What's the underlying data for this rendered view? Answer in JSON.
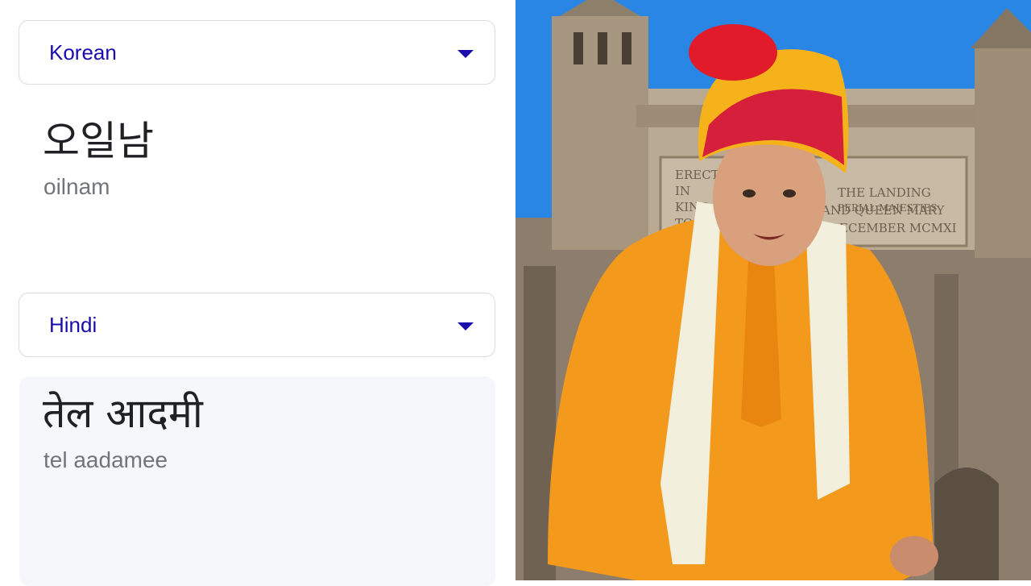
{
  "source": {
    "language": "Korean",
    "text": "오일남",
    "romanization": "oilnam"
  },
  "target": {
    "language": "Hindi",
    "text": "तेल आदमी",
    "romanization": "tel aadamee"
  },
  "photo": {
    "inscription_lines": [
      "ERECT",
      "IN",
      "KING",
      "TO",
      "AND QUEEN MARY",
      "DECEMBER MCMXI",
      "THE LANDING",
      "PERIAL MAJESTIES"
    ]
  },
  "colors": {
    "accent": "#1a0dab",
    "sky": "#1f7fe0",
    "kurta": "#f39a1c",
    "turban_red": "#d61f3a",
    "turban_yellow": "#f6b21a"
  },
  "icons": {
    "dropdown": "chevron-down-icon"
  }
}
